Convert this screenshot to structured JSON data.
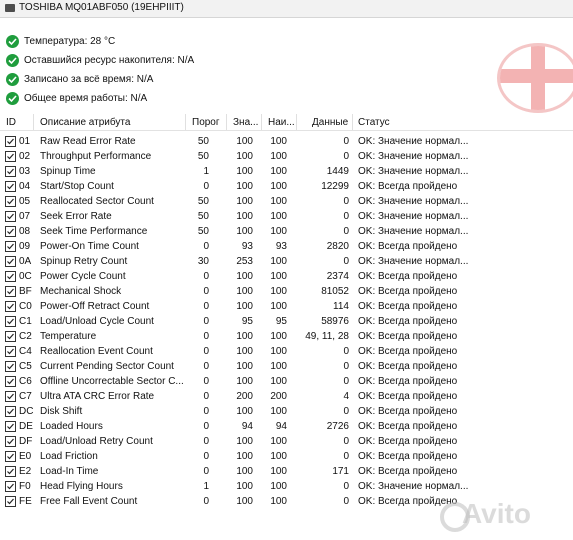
{
  "window": {
    "title": "TOSHIBA MQ01ABF050 (19EHPIIIT)"
  },
  "info": [
    {
      "label": "Температура: 28 °C"
    },
    {
      "label": "Оставшийся ресурс накопителя: N/A"
    },
    {
      "label": "Записано за всё время: N/A"
    },
    {
      "label": "Общее время работы: N/A"
    }
  ],
  "table": {
    "columns": [
      "ID",
      "Описание атрибута",
      "Порог",
      "Зна...",
      "Наи...",
      "Данные",
      "Статус"
    ],
    "rows": [
      {
        "id": "01",
        "desc": "Raw Read Error Rate",
        "thr": "50",
        "val": "100",
        "worst": "100",
        "data": "0",
        "status": "OK: Значение нормал..."
      },
      {
        "id": "02",
        "desc": "Throughput Performance",
        "thr": "50",
        "val": "100",
        "worst": "100",
        "data": "0",
        "status": "OK: Значение нормал..."
      },
      {
        "id": "03",
        "desc": "Spinup Time",
        "thr": "1",
        "val": "100",
        "worst": "100",
        "data": "1449",
        "status": "OK: Значение нормал..."
      },
      {
        "id": "04",
        "desc": "Start/Stop Count",
        "thr": "0",
        "val": "100",
        "worst": "100",
        "data": "12299",
        "status": "OK: Всегда пройдено"
      },
      {
        "id": "05",
        "desc": "Reallocated Sector Count",
        "thr": "50",
        "val": "100",
        "worst": "100",
        "data": "0",
        "status": "OK: Значение нормал..."
      },
      {
        "id": "07",
        "desc": "Seek Error Rate",
        "thr": "50",
        "val": "100",
        "worst": "100",
        "data": "0",
        "status": "OK: Значение нормал..."
      },
      {
        "id": "08",
        "desc": "Seek Time Performance",
        "thr": "50",
        "val": "100",
        "worst": "100",
        "data": "0",
        "status": "OK: Значение нормал..."
      },
      {
        "id": "09",
        "desc": "Power-On Time Count",
        "thr": "0",
        "val": "93",
        "worst": "93",
        "data": "2820",
        "status": "OK: Всегда пройдено"
      },
      {
        "id": "0A",
        "desc": "Spinup Retry Count",
        "thr": "30",
        "val": "253",
        "worst": "100",
        "data": "0",
        "status": "OK: Значение нормал..."
      },
      {
        "id": "0C",
        "desc": "Power Cycle Count",
        "thr": "0",
        "val": "100",
        "worst": "100",
        "data": "2374",
        "status": "OK: Всегда пройдено"
      },
      {
        "id": "BF",
        "desc": "Mechanical Shock",
        "thr": "0",
        "val": "100",
        "worst": "100",
        "data": "81052",
        "status": "OK: Всегда пройдено"
      },
      {
        "id": "C0",
        "desc": "Power-Off Retract Count",
        "thr": "0",
        "val": "100",
        "worst": "100",
        "data": "114",
        "status": "OK: Всегда пройдено"
      },
      {
        "id": "C1",
        "desc": "Load/Unload Cycle Count",
        "thr": "0",
        "val": "95",
        "worst": "95",
        "data": "58976",
        "status": "OK: Всегда пройдено"
      },
      {
        "id": "C2",
        "desc": "Temperature",
        "thr": "0",
        "val": "100",
        "worst": "100",
        "data": "49, 11, 28",
        "status": "OK: Всегда пройдено"
      },
      {
        "id": "C4",
        "desc": "Reallocation Event Count",
        "thr": "0",
        "val": "100",
        "worst": "100",
        "data": "0",
        "status": "OK: Всегда пройдено"
      },
      {
        "id": "C5",
        "desc": "Current Pending Sector Count",
        "thr": "0",
        "val": "100",
        "worst": "100",
        "data": "0",
        "status": "OK: Всегда пройдено"
      },
      {
        "id": "C6",
        "desc": "Offline Uncorrectable Sector C...",
        "thr": "0",
        "val": "100",
        "worst": "100",
        "data": "0",
        "status": "OK: Всегда пройдено"
      },
      {
        "id": "C7",
        "desc": "Ultra ATA CRC Error Rate",
        "thr": "0",
        "val": "200",
        "worst": "200",
        "data": "4",
        "status": "OK: Всегда пройдено"
      },
      {
        "id": "DC",
        "desc": "Disk Shift",
        "thr": "0",
        "val": "100",
        "worst": "100",
        "data": "0",
        "status": "OK: Всегда пройдено"
      },
      {
        "id": "DE",
        "desc": "Loaded Hours",
        "thr": "0",
        "val": "94",
        "worst": "94",
        "data": "2726",
        "status": "OK: Всегда пройдено"
      },
      {
        "id": "DF",
        "desc": "Load/Unload Retry Count",
        "thr": "0",
        "val": "100",
        "worst": "100",
        "data": "0",
        "status": "OK: Всегда пройдено"
      },
      {
        "id": "E0",
        "desc": "Load Friction",
        "thr": "0",
        "val": "100",
        "worst": "100",
        "data": "0",
        "status": "OK: Всегда пройдено"
      },
      {
        "id": "E2",
        "desc": "Load-In Time",
        "thr": "0",
        "val": "100",
        "worst": "100",
        "data": "171",
        "status": "OK: Всегда пройдено"
      },
      {
        "id": "F0",
        "desc": "Head Flying Hours",
        "thr": "1",
        "val": "100",
        "worst": "100",
        "data": "0",
        "status": "OK: Значение нормал..."
      },
      {
        "id": "FE",
        "desc": "Free Fall Event Count",
        "thr": "0",
        "val": "100",
        "worst": "100",
        "data": "0",
        "status": "OK: Всегда пройдено"
      }
    ]
  },
  "colors": {
    "ok_green": "#1f9d3d",
    "health_cross": "#f3b3b3"
  },
  "icons": {
    "drive": "drive-icon",
    "ok": "check-icon",
    "health": "red-cross-icon",
    "row_check": "checkbox-checked-icon"
  },
  "watermark": {
    "text": "Avito"
  }
}
